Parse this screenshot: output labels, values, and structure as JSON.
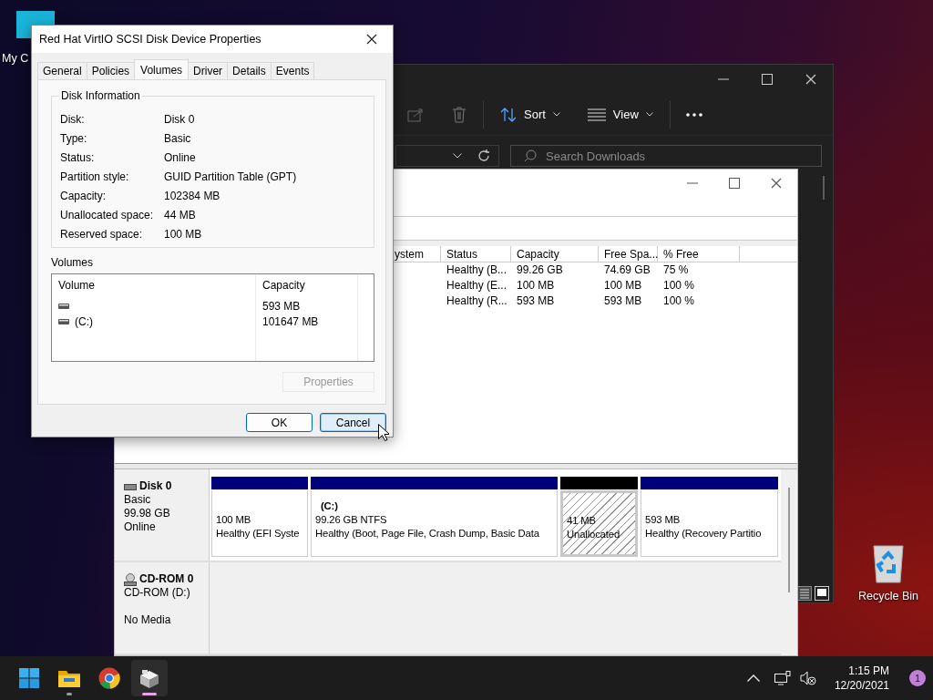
{
  "desktop_icons": [
    {
      "kind": "computer",
      "label": "My C"
    },
    {
      "kind": "recycle",
      "label": "Recycle Bin"
    }
  ],
  "file_explorer": {
    "sort": "Sort",
    "view": "View",
    "search": {
      "placeholder": "Search Downloads"
    }
  },
  "disk_management": {
    "columns": [
      "ystem",
      "Status",
      "Capacity",
      "Free Spa...",
      "% Free"
    ],
    "rows": [
      {
        "status": "Healthy (B...",
        "capacity": "99.26 GB",
        "free_space": "74.69 GB",
        "percent_free": "75 %"
      },
      {
        "status": "Healthy (E...",
        "capacity": "100 MB",
        "free_space": "100 MB",
        "percent_free": "100 %"
      },
      {
        "status": "Healthy (R...",
        "capacity": "593 MB",
        "free_space": "593 MB",
        "percent_free": "100 %"
      }
    ],
    "disks": [
      {
        "kind": "disk",
        "name": "Disk 0",
        "type": "Basic",
        "size": "99.98 GB",
        "status": "Online",
        "partitions": [
          {
            "kind": "primary",
            "size": "100 MB",
            "status": "Healthy (EFI Syste"
          },
          {
            "kind": "primary",
            "label": "(C:)",
            "size": "99.26 GB NTFS",
            "status": "Healthy (Boot, Page File, Crash Dump, Basic Data"
          },
          {
            "kind": "unallocated",
            "size": "41 MB",
            "status": "Unallocated"
          },
          {
            "kind": "primary",
            "size": "593 MB",
            "status": "Healthy (Recovery Partitio"
          }
        ]
      },
      {
        "kind": "cdrom",
        "name": "CD-ROM 0",
        "type": "CD-ROM (D:)",
        "status": "No Media"
      }
    ]
  },
  "properties_dialog": {
    "title": "Red Hat VirtIO SCSI Disk Device Properties",
    "tabs": [
      {
        "label": "General",
        "selected": false
      },
      {
        "label": "Policies",
        "selected": false
      },
      {
        "label": "Volumes",
        "selected": true
      },
      {
        "label": "Driver",
        "selected": false
      },
      {
        "label": "Details",
        "selected": false
      },
      {
        "label": "Events",
        "selected": false
      }
    ],
    "disk_information": {
      "legend": "Disk Information",
      "fields": [
        {
          "label": "Disk:",
          "value": "Disk 0"
        },
        {
          "label": "Type:",
          "value": "Basic"
        },
        {
          "label": "Status:",
          "value": "Online"
        },
        {
          "label": "Partition style:",
          "value": "GUID Partition Table (GPT)"
        },
        {
          "label": "Capacity:",
          "value": "102384 MB"
        },
        {
          "label": "Unallocated space:",
          "value": "44 MB"
        },
        {
          "label": "Reserved space:",
          "value": "100 MB"
        }
      ]
    },
    "volumes": {
      "label": "Volumes",
      "columns": [
        "Volume",
        "Capacity"
      ],
      "rows": [
        {
          "capacity": "593 MB"
        },
        {
          "volume": "(C:)",
          "capacity": "101647 MB"
        }
      ]
    },
    "properties_button": {
      "label": "Properties",
      "disabled": true
    },
    "buttons": [
      {
        "label": "OK",
        "focused": false
      },
      {
        "label": "Cancel",
        "focused": true
      }
    ]
  },
  "taskbar": {
    "apps": [
      {
        "kind": "start",
        "running": false,
        "selected": false
      },
      {
        "kind": "explorer",
        "running": true,
        "selected": false
      },
      {
        "kind": "chrome",
        "running": false,
        "selected": false
      },
      {
        "kind": "disk",
        "running": true,
        "selected": true
      }
    ],
    "time": "1:15 PM",
    "date": "12/20/2021",
    "notifications": "1"
  }
}
